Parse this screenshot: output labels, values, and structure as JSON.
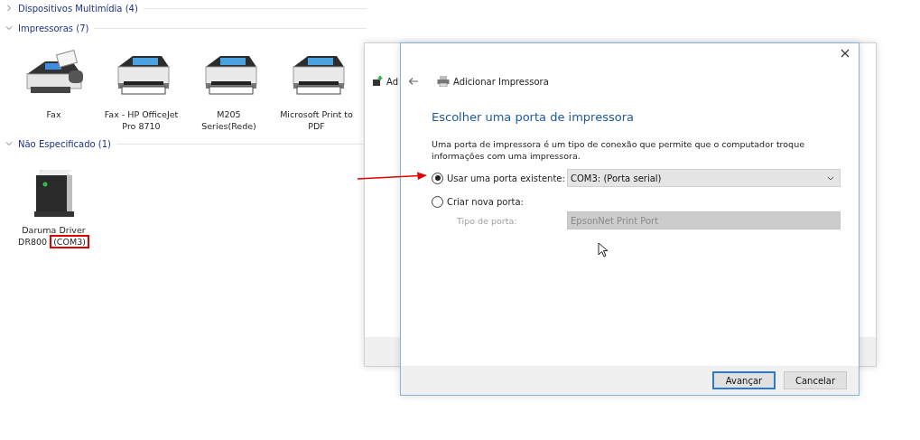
{
  "explorer": {
    "groups": [
      {
        "title": "Dispositivos Multimídia (4)",
        "expanded": false
      },
      {
        "title": "Impressoras (7)",
        "expanded": true,
        "items": [
          {
            "kind": "fax",
            "label": "Fax"
          },
          {
            "kind": "printer",
            "label": "Fax - HP OfficeJet Pro 8710"
          },
          {
            "kind": "printer",
            "label": "M205 Series(Rede)"
          },
          {
            "kind": "printer",
            "label": "Microsoft Print to PDF"
          }
        ]
      },
      {
        "title": "Não Especificado (1)",
        "expanded": true,
        "items": [
          {
            "kind": "device",
            "label": "Daruma Driver DR800",
            "tag": "(COM3)",
            "marked": true
          }
        ]
      }
    ]
  },
  "back_window": {
    "title": "Ad"
  },
  "dialog": {
    "title": "Adicionar Impressora",
    "heading": "Escolher uma porta de impressora",
    "description": "Uma porta de impressora é um tipo de conexão que permite que o computador troque informações com uma impressora.",
    "options": [
      {
        "kind": "select",
        "label": "Usar uma porta existente:",
        "selected": true,
        "value": "COM3: (Porta serial)",
        "pointed": true
      },
      {
        "kind": "field",
        "label": "Criar nova porta:",
        "selected": false,
        "field_label": "Tipo de porta:",
        "value": "EpsonNet Print Port",
        "disabled": true
      }
    ],
    "buttons": [
      {
        "label": "Avançar",
        "default": true
      },
      {
        "label": "Cancelar",
        "default": false
      }
    ]
  }
}
